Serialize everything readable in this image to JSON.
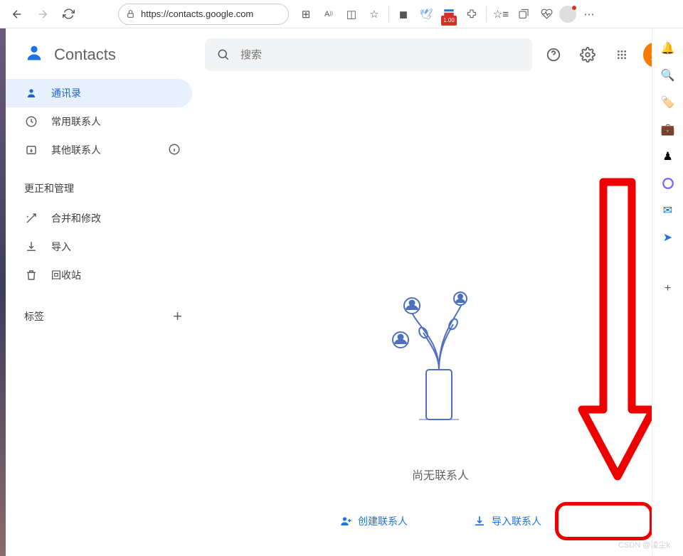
{
  "browser": {
    "url": "https://contacts.google.com",
    "badge": "1.00"
  },
  "brand": {
    "title": "Contacts"
  },
  "sidebar": {
    "items": [
      {
        "label": "通讯录"
      },
      {
        "label": "常用联系人"
      },
      {
        "label": "其他联系人"
      }
    ],
    "section1": "更正和管理",
    "manage": [
      {
        "label": "合并和修改"
      },
      {
        "label": "导入"
      },
      {
        "label": "回收站"
      }
    ],
    "labels_header": "标签"
  },
  "search": {
    "placeholder": "搜索"
  },
  "avatar": {
    "initial": "尘"
  },
  "empty": {
    "text": "尚无联系人",
    "create": "创建联系人",
    "import": "导入联系人"
  },
  "watermark": "CSDN @凌尘k"
}
